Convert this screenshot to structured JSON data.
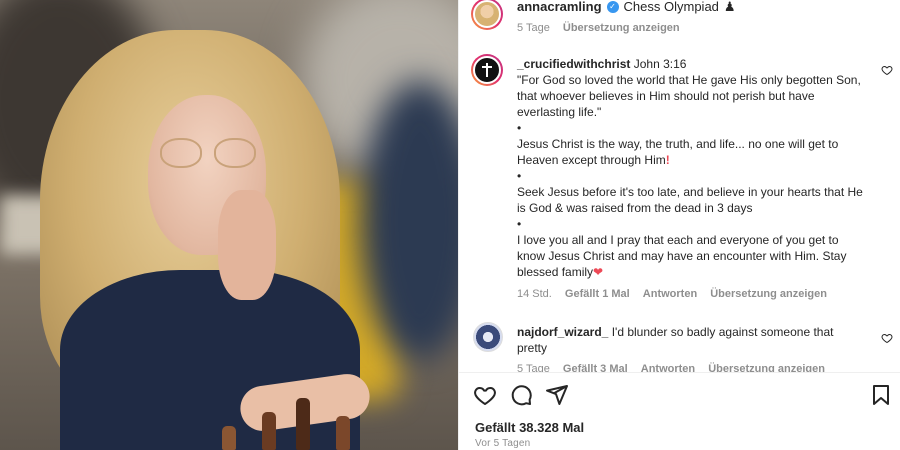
{
  "post": {
    "author": "annacramling",
    "caption": "Chess Olympiad",
    "caption_emoji": "♟",
    "time": "5 Tage",
    "translate": "Übersetzung anzeigen"
  },
  "comments": [
    {
      "user": "_crucifiedwithchrist",
      "lines": [
        "John 3:16",
        "\"For God so loved the world that He gave His only begotten Son, that whoever believes in Him should not perish but have everlasting life.\"",
        "•",
        "Jesus Christ is the way, the truth, and life... no one will get to Heaven except through Him",
        "•",
        "Seek Jesus before it's too late, and believe in your hearts that He is God & was raised from the dead in 3 days",
        "•",
        "I love you all and I pray that each and everyone of you get to know Jesus Christ and may have an encounter with Him. Stay blessed family"
      ],
      "exclaim": "!",
      "heart": "❤",
      "time": "14 Std.",
      "likes": "Gefällt 1 Mal",
      "reply": "Antworten",
      "translate": "Übersetzung anzeigen"
    },
    {
      "user": "najdorf_wizard_",
      "text": "I'd blunder so badly against someone that pretty",
      "time": "5 Tage",
      "likes": "Gefällt 3 Mal",
      "reply": "Antworten",
      "translate": "Übersetzung anzeigen"
    }
  ],
  "footer": {
    "likes": "Gefällt 38.328 Mal",
    "ago": "Vor 5 Tagen"
  },
  "icons": {
    "like": "heart-icon",
    "comment": "comment-icon",
    "share": "paper-plane-icon",
    "save": "bookmark-icon"
  },
  "colors": {
    "verified": "#3897f0",
    "muted": "#8e8e8e",
    "red": "#ed4956"
  }
}
